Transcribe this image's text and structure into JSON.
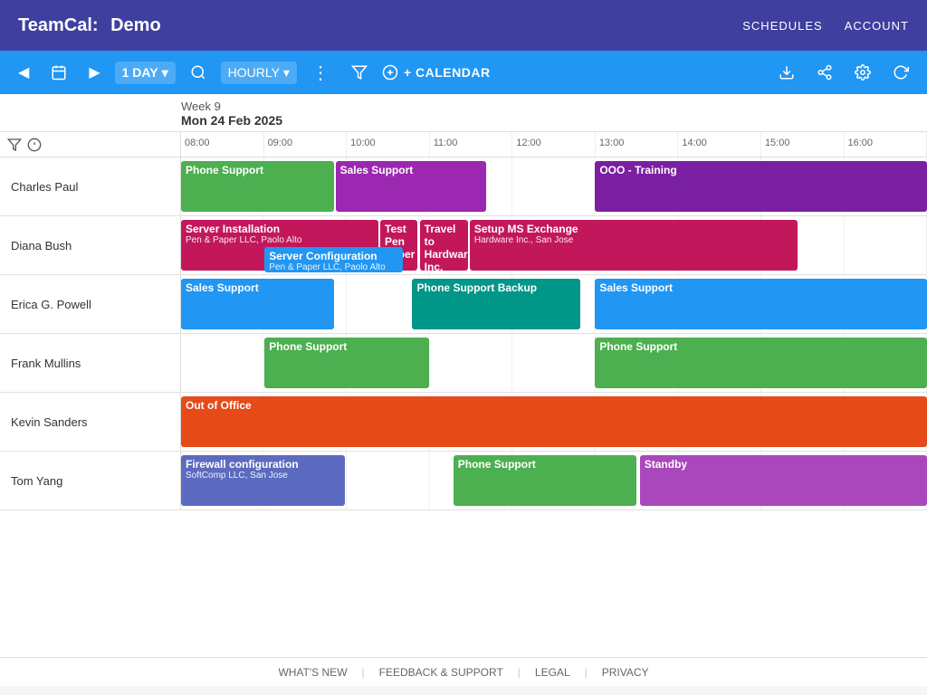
{
  "app": {
    "title": "TeamCal:",
    "demo": "Demo",
    "nav": [
      "SCHEDULES",
      "ACCOUNT"
    ]
  },
  "toolbar": {
    "prev_label": "◀",
    "today_label": "📅",
    "next_label": "▶",
    "view": "1 DAY",
    "view_arrow": "▾",
    "hourly": "HOURLY",
    "hourly_arrow": "▾",
    "more": "⋮",
    "search": "🔍",
    "filter": "⊿",
    "add_calendar": "+ CALENDAR",
    "download": "⬇",
    "share": "⇧",
    "settings": "⚙",
    "refresh": "↺"
  },
  "week_info": {
    "week": "Week 9",
    "date": "Mon 24 Feb 2025"
  },
  "time_slots": [
    "08:00",
    "09:00",
    "10:00",
    "11:00",
    "12:00",
    "13:00",
    "14:00",
    "15:00",
    "16:00"
  ],
  "people": [
    {
      "name": "Charles Paul",
      "events": [
        {
          "title": "Phone Support",
          "color": "color-green",
          "left": "0%",
          "width": "20.5%"
        },
        {
          "title": "Sales Support",
          "color": "color-purple",
          "left": "20.7%",
          "width": "20.2%"
        },
        {
          "title": "OOO - Training",
          "color": "color-violet",
          "left": "55.5%",
          "width": "44.5%"
        }
      ]
    },
    {
      "name": "Diana Bush",
      "events": [
        {
          "title": "Server Installation",
          "sub": "Pen & Paper LLC, Paolo Alto",
          "color": "color-crimson",
          "left": "0%",
          "width": "26.5%"
        },
        {
          "title": "Test Pen Paper",
          "color": "color-crimson",
          "left": "26.7%",
          "width": "5%"
        },
        {
          "title": "Travel to Hardware Inc.",
          "color": "color-crimson",
          "left": "32%",
          "width": "6.5%"
        },
        {
          "title": "Setup MS Exchange",
          "sub": "Hardware Inc., San Jose",
          "color": "color-crimson",
          "left": "38.7%",
          "width": "44%"
        },
        {
          "title": "Server Configuration",
          "sub": "Pen & Paper LLC, Paolo Alto",
          "color": "color-blue",
          "left": "11.2%",
          "width": "18.5%",
          "top": "true"
        }
      ]
    },
    {
      "name": "Erica G. Powell",
      "events": [
        {
          "title": "Sales Support",
          "color": "color-blue",
          "left": "0%",
          "width": "20.5%"
        },
        {
          "title": "Phone Support Backup",
          "color": "color-teal",
          "left": "31%",
          "width": "22.5%"
        },
        {
          "title": "Sales Support",
          "color": "color-blue",
          "left": "55.5%",
          "width": "44.5%"
        }
      ]
    },
    {
      "name": "Frank Mullins",
      "events": [
        {
          "title": "Phone Support",
          "color": "color-green",
          "left": "11.2%",
          "width": "22%"
        },
        {
          "title": "Phone Support",
          "color": "color-green",
          "left": "55.5%",
          "width": "44.5%"
        }
      ]
    },
    {
      "name": "Kevin Sanders",
      "events": [
        {
          "title": "Out of Office",
          "color": "color-orange",
          "left": "0%",
          "width": "100%"
        }
      ]
    },
    {
      "name": "Tom Yang",
      "events": [
        {
          "title": "Firewall configuration",
          "sub": "SoftComp LLC, San Jose",
          "color": "color-indigo",
          "left": "0%",
          "width": "22%"
        },
        {
          "title": "Phone Support",
          "color": "color-green",
          "left": "36.5%",
          "width": "24.5%"
        },
        {
          "title": "Standby",
          "color": "color-light-purple",
          "left": "61.5%",
          "width": "38.5%"
        }
      ]
    }
  ],
  "footer": {
    "whats_new": "WHAT'S NEW",
    "feedback": "FEEDBACK & SUPPORT",
    "legal": "LEGAL",
    "privacy": "PRIVACY"
  }
}
